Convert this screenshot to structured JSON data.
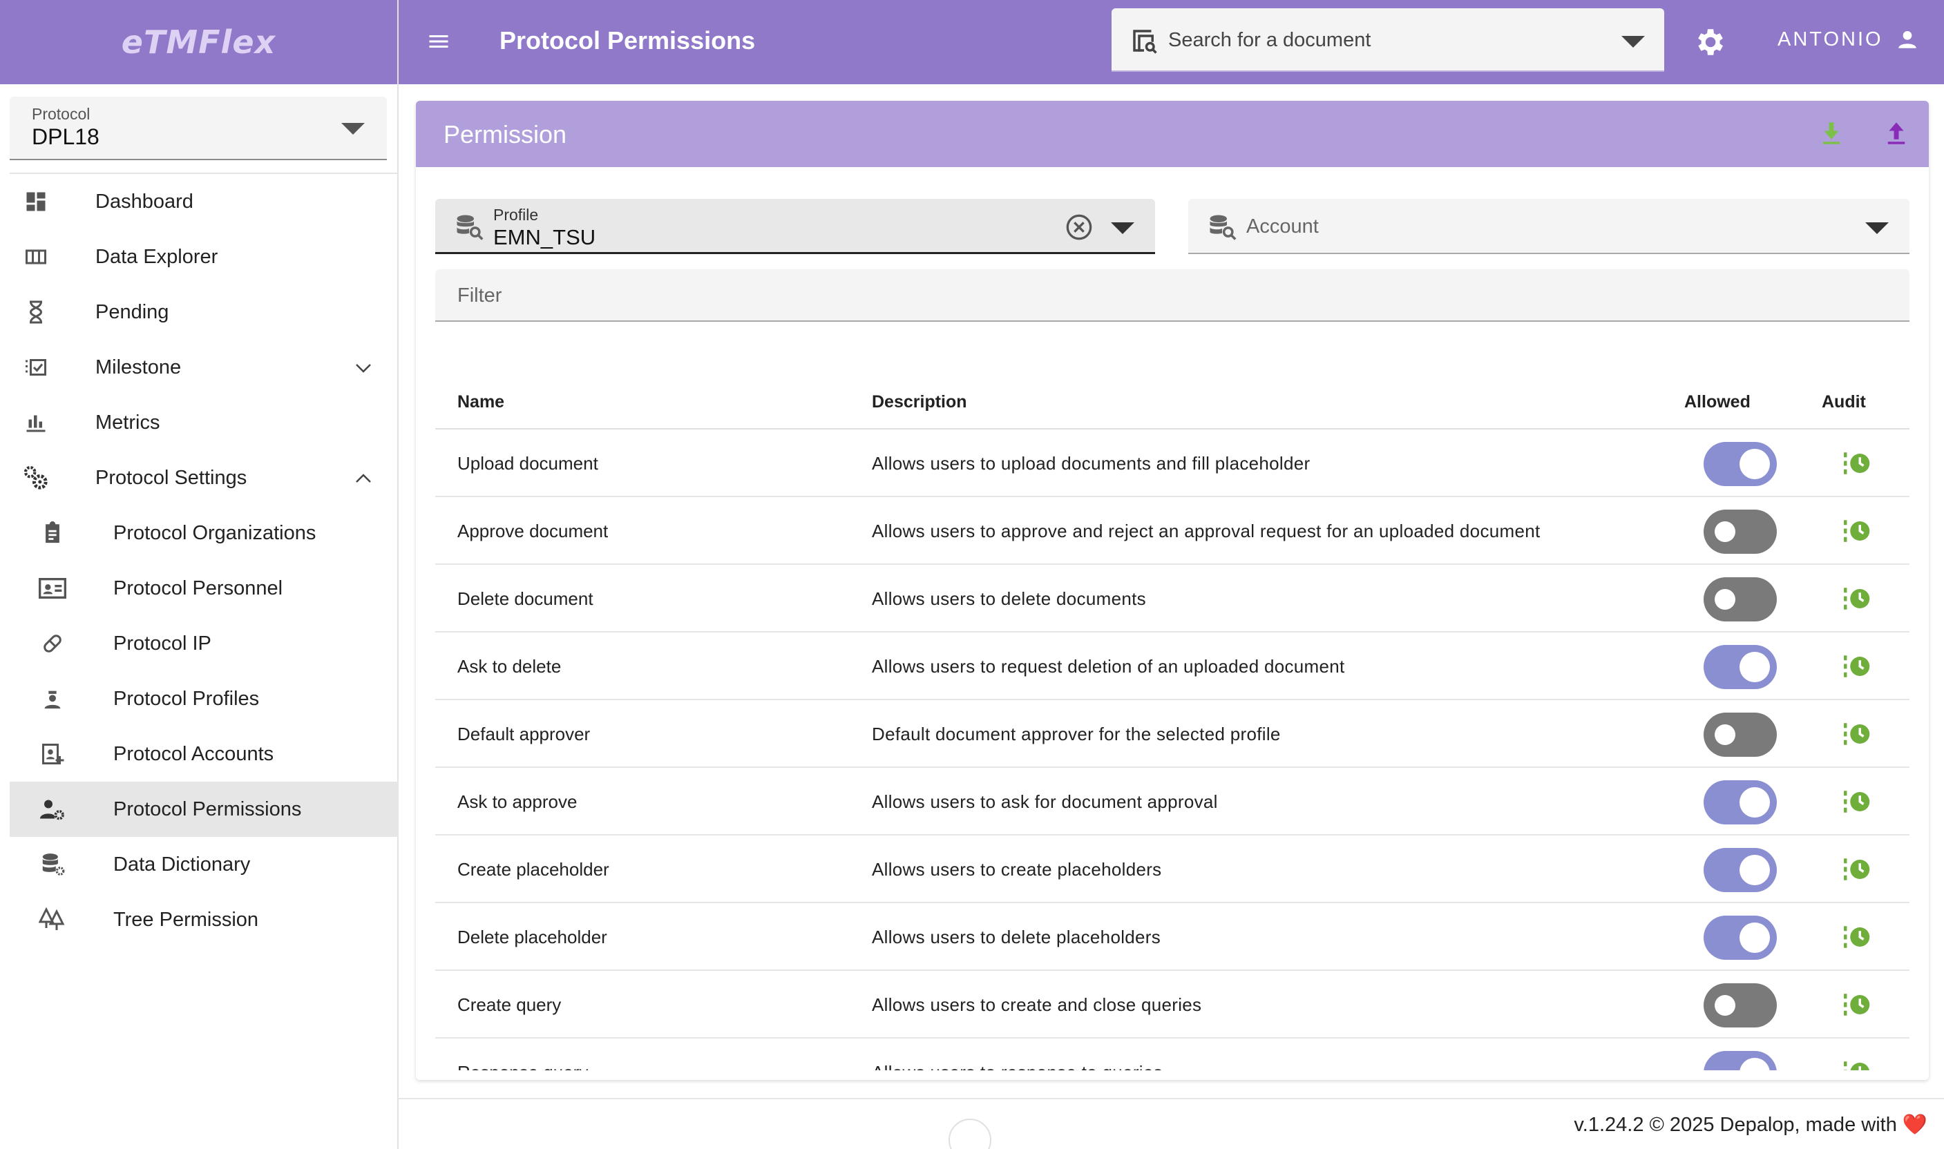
{
  "app": {
    "logo": "eTMFlex"
  },
  "sidebar": {
    "protocol_label": "Protocol",
    "protocol_value": "DPL18",
    "items": [
      {
        "label": "Dashboard",
        "icon": "dashboard-icon"
      },
      {
        "label": "Data Explorer",
        "icon": "columns-icon"
      },
      {
        "label": "Pending",
        "icon": "hourglass-icon"
      },
      {
        "label": "Milestone",
        "icon": "checklist-icon",
        "expand": "chevron-down-icon"
      },
      {
        "label": "Metrics",
        "icon": "bar-chart-icon"
      },
      {
        "label": "Protocol Settings",
        "icon": "cogs-icon",
        "expand": "chevron-up-icon"
      },
      {
        "label": "Protocol Organizations",
        "icon": "clipboard-badge-icon"
      },
      {
        "label": "Protocol Personnel",
        "icon": "id-card-icon"
      },
      {
        "label": "Protocol IP",
        "icon": "pill-icon"
      },
      {
        "label": "Protocol Profiles",
        "icon": "person-badge-icon"
      },
      {
        "label": "Protocol Accounts",
        "icon": "account-box-icon"
      },
      {
        "label": "Protocol Permissions",
        "icon": "user-gear-icon",
        "active": true
      },
      {
        "label": "Data Dictionary",
        "icon": "database-gear-icon"
      },
      {
        "label": "Tree Permission",
        "icon": "tree-icon"
      }
    ]
  },
  "header": {
    "title": "Protocol Permissions",
    "search_placeholder": "Search for a document",
    "user": "ANTONIO"
  },
  "card": {
    "title": "Permission",
    "profile_label": "Profile",
    "profile_value": "EMN_TSU",
    "account_placeholder": "Account",
    "filter_placeholder": "Filter"
  },
  "table": {
    "columns": [
      "Name",
      "Description",
      "Allowed",
      "Audit"
    ],
    "rows": [
      {
        "name": "Upload document",
        "description": "Allows users to upload documents and fill placeholder",
        "allowed": true
      },
      {
        "name": "Approve document",
        "description": "Allows users to approve and reject an approval request for an uploaded document",
        "allowed": false
      },
      {
        "name": "Delete document",
        "description": "Allows users to delete documents",
        "allowed": false
      },
      {
        "name": "Ask to delete",
        "description": "Allows users to request deletion of an uploaded document",
        "allowed": true
      },
      {
        "name": "Default approver",
        "description": "Default document approver for the selected profile",
        "allowed": false
      },
      {
        "name": "Ask to approve",
        "description": "Allows users to ask for document approval",
        "allowed": true
      },
      {
        "name": "Create placeholder",
        "description": "Allows users to create placeholders",
        "allowed": true
      },
      {
        "name": "Delete placeholder",
        "description": "Allows users to delete placeholders",
        "allowed": true
      },
      {
        "name": "Create query",
        "description": "Allows users to create and close queries",
        "allowed": false
      },
      {
        "name": "Response query",
        "description": "Allows users to response to queries",
        "allowed": true
      }
    ]
  },
  "footer": {
    "text": "v.1.24.2 © 2025 Depalop, made with ❤️"
  },
  "colors": {
    "brand": "#9079c9",
    "card_header": "#b19fdc",
    "toggle_on": "#8a8fd1",
    "toggle_off": "#7a7a7a",
    "audit": "#6fae3b"
  }
}
